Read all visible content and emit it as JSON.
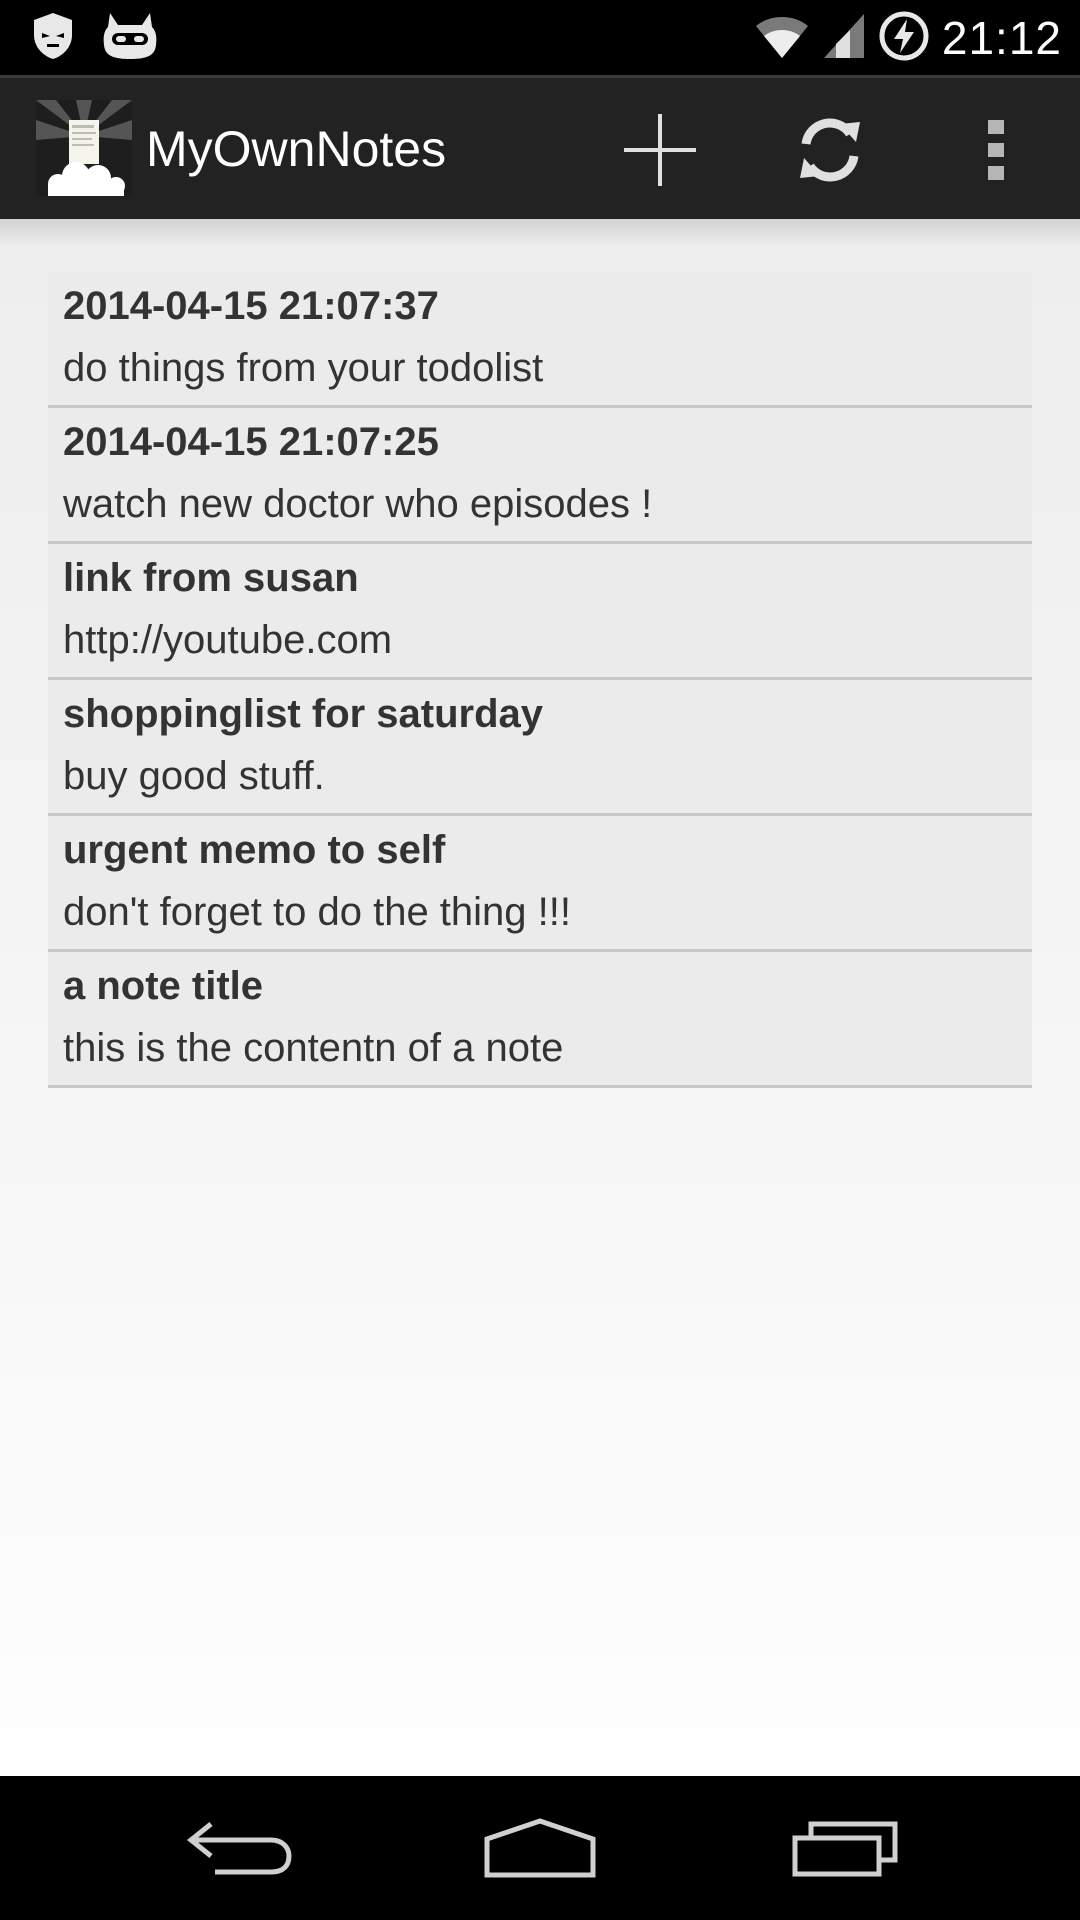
{
  "status_bar": {
    "time": "21:12",
    "icons": [
      "shield-notification-icon",
      "cyanogen-mascot-icon",
      "wifi-icon",
      "signal-icon",
      "battery-charging-icon"
    ]
  },
  "action_bar": {
    "app_title": "MyOwnNotes",
    "actions": [
      "add-icon",
      "sync-icon",
      "overflow-menu-icon"
    ]
  },
  "notes": [
    {
      "title": "2014-04-15 21:07:37",
      "content": "do things from your todolist"
    },
    {
      "title": "2014-04-15 21:07:25",
      "content": "watch new doctor who episodes !"
    },
    {
      "title": "link from susan",
      "content": "http://youtube.com"
    },
    {
      "title": "shoppinglist for saturday",
      "content": "buy good stuff."
    },
    {
      "title": "urgent memo to self",
      "content": "don't forget to do the thing !!!"
    },
    {
      "title": "a note title",
      "content": "this is the contentn of a note"
    }
  ],
  "nav_bar": {
    "buttons": [
      "back-icon",
      "home-icon",
      "recent-apps-icon"
    ]
  },
  "colors": {
    "status_bar": "#000000",
    "action_bar": "#222222",
    "list_item_bg": "#ebebeb",
    "divider": "#c8c8c8",
    "text": "#333333"
  }
}
